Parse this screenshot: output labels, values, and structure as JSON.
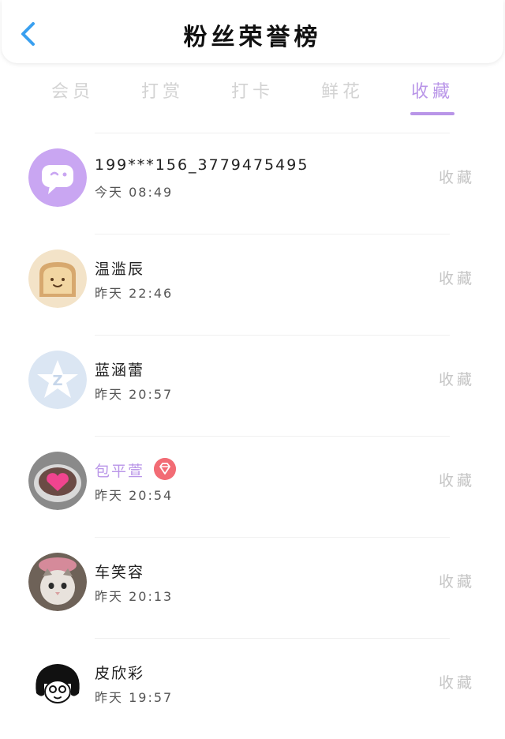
{
  "header": {
    "title": "粉丝荣誉榜",
    "back_icon": "chevron-left-icon"
  },
  "tabs": [
    {
      "label": "会员"
    },
    {
      "label": "打赏"
    },
    {
      "label": "打卡"
    },
    {
      "label": "鲜花"
    },
    {
      "label": "收藏"
    }
  ],
  "active_tab": "收藏",
  "list": [
    {
      "name": "199***156_3779475495",
      "time": "今天 08:49",
      "action": "收藏",
      "avatar": "chat-bubble-avatar"
    },
    {
      "name": "温滥辰",
      "time": "昨天 22:46",
      "action": "收藏",
      "avatar": "toast-avatar"
    },
    {
      "name": "蓝涵蕾",
      "time": "昨天 20:57",
      "action": "收藏",
      "avatar": "star-avatar"
    },
    {
      "name": "包平萱",
      "time": "昨天 20:54",
      "action": "收藏",
      "avatar": "heart-cup-avatar",
      "badge": "diamond-icon"
    },
    {
      "name": "车笑容",
      "time": "昨天 20:13",
      "action": "收藏",
      "avatar": "cat-avatar"
    },
    {
      "name": "皮欣彩",
      "time": "昨天 19:57",
      "action": "收藏",
      "avatar": "cartoon-face-avatar"
    }
  ],
  "colors": {
    "accent": "#b995e8",
    "badge": "#f26c75",
    "back": "#3aa0f0",
    "inactive_tab": "#d3d3d3",
    "action_text": "#c5c5c5"
  }
}
